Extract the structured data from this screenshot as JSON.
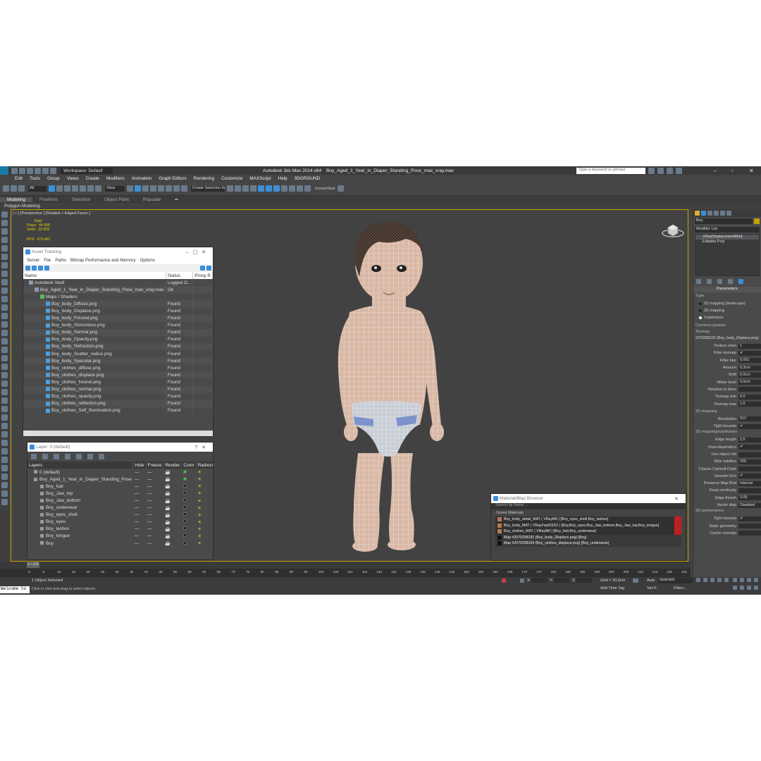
{
  "app": {
    "title": "Autodesk 3ds Max  2014 x64",
    "file": "Boy_Aged_1_Year_in_Diaper_Standing_Pose_max_vray.max",
    "workspace": "Workspace: Default",
    "search_placeholder": "Type a keyword or phrase"
  },
  "menu": [
    "Edit",
    "Tools",
    "Group",
    "Views",
    "Create",
    "Modifiers",
    "Animation",
    "Graph Editors",
    "Rendering",
    "Customize",
    "MAXScript",
    "Help",
    "3DGROUND"
  ],
  "toolbar": {
    "selection_filter": "All",
    "view": "View",
    "named_set": "Create Selection Se",
    "screenshot": "ScreenShot"
  },
  "ribbon": {
    "tabs": [
      "Modeling",
      "Freeform",
      "Selection",
      "Object Paint",
      "Populate"
    ],
    "sub": "Polygon Modeling"
  },
  "viewport": {
    "label": "[ + ] [Perspective ] [Shaded + Edged Faces ]",
    "stats": {
      "total": "Total",
      "polys_label": "Polys:",
      "polys": "44 568",
      "verts_label": "Verts:",
      "verts": "33 059",
      "fps_label": "FPS:",
      "fps": "479,462"
    }
  },
  "asset_tracking": {
    "title": "Asset Tracking",
    "menu": [
      "Server",
      "File",
      "Paths",
      "Bitmap Performance and Memory",
      "Options"
    ],
    "columns": [
      "Name",
      "Status",
      "Proxy R"
    ],
    "rows": [
      {
        "name": "Autodesk Vault",
        "status": "Logged O...",
        "indent": 1
      },
      {
        "name": "Boy_Aged_1_Year_in_Diaper_Standing_Pose_max_vray.max",
        "status": "Ok",
        "indent": 2
      },
      {
        "name": "Maps / Shaders",
        "status": "",
        "indent": 3
      },
      {
        "name": "Boy_body_Diffuse.png",
        "status": "Found",
        "indent": 4
      },
      {
        "name": "Boy_body_Displace.png",
        "status": "Found",
        "indent": 4
      },
      {
        "name": "Boy_body_Fresnel.png",
        "status": "Found",
        "indent": 4
      },
      {
        "name": "Boy_body_Glossiness.png",
        "status": "Found",
        "indent": 4
      },
      {
        "name": "Boy_body_Normal.png",
        "status": "Found",
        "indent": 4
      },
      {
        "name": "Boy_body_Opacity.png",
        "status": "Found",
        "indent": 4
      },
      {
        "name": "Boy_body_Refraction.png",
        "status": "Found",
        "indent": 4
      },
      {
        "name": "Boy_body_Scatter_radius.png",
        "status": "Found",
        "indent": 4
      },
      {
        "name": "Boy_body_Specular.png",
        "status": "Found",
        "indent": 4
      },
      {
        "name": "Boy_clothes_diffuse.png",
        "status": "Found",
        "indent": 4
      },
      {
        "name": "Boy_clothes_displace.png",
        "status": "Found",
        "indent": 4
      },
      {
        "name": "Boy_clothes_fresnel.png",
        "status": "Found",
        "indent": 4
      },
      {
        "name": "Boy_clothes_normal.png",
        "status": "Found",
        "indent": 4
      },
      {
        "name": "Boy_clothes_opacity.png",
        "status": "Found",
        "indent": 4
      },
      {
        "name": "Boy_clothes_reflection.png",
        "status": "Found",
        "indent": 4
      },
      {
        "name": "Boy_clothes_Self_Illumination.png",
        "status": "Found",
        "indent": 4
      }
    ]
  },
  "layer": {
    "title": "Layer: 0 (default)",
    "columns": [
      "Layers",
      "Hide",
      "Freeze",
      "Render",
      "Color",
      "Radiosity"
    ],
    "rows": [
      {
        "name": "0 (default)",
        "indent": 1,
        "color": "g"
      },
      {
        "name": "Boy_Aged_1_Year_in_Diaper_Standing_Pose",
        "indent": 1,
        "color": "g"
      },
      {
        "name": "Boy_hair",
        "indent": 2,
        "color": ""
      },
      {
        "name": "Boy_Jaw_top",
        "indent": 2,
        "color": ""
      },
      {
        "name": "Boy_Jaw_bottom",
        "indent": 2,
        "color": ""
      },
      {
        "name": "Boy_underwear",
        "indent": 2,
        "color": ""
      },
      {
        "name": "Boy_eyes_shell",
        "indent": 2,
        "color": ""
      },
      {
        "name": "Boy_eyes",
        "indent": 2,
        "color": ""
      },
      {
        "name": "Boy_lashes",
        "indent": 2,
        "color": ""
      },
      {
        "name": "Boy_tongue",
        "indent": 2,
        "color": ""
      },
      {
        "name": "Boy",
        "indent": 2,
        "color": ""
      }
    ]
  },
  "material_browser": {
    "title": "Material/Map Browser",
    "search": "Search by Name ...",
    "section": "- Scene Materials",
    "rows": [
      "Boy_body_detail_MAT ( VRayMtl ) [Boy_eyes_shell,Boy_lashes]",
      "Boy_body_MAT ( VRayFastSSS2 ) [Boy,Boy_eyes,Boy_Jaw_bottom,Boy_Jaw_top,Boy_tongue]",
      "Boy_clothes_MAT ( VRayMtl ) [Boy_hair,Boy_underwear]",
      "Map #2070298191 (Boy_body_Displace.png) [Boy]",
      "Map #2070298194 (Boy_clothes_displace.png) [Boy_underwear]"
    ]
  },
  "right_panel": {
    "name": "Boy",
    "modifier_list": "Modifier List",
    "stack": [
      "VRayDisplacementMod",
      "Editable Poly"
    ],
    "parameters": "Parameters",
    "type": "Type",
    "types": [
      "2D mapping (landscape)",
      "3D mapping",
      "Subdivision"
    ],
    "common": "Common params",
    "texmap": "Texmap",
    "texmap_value": "2070298191 (Boy_body_Displace.png)",
    "params1": [
      {
        "l": "Texture chan",
        "v": "1"
      },
      {
        "l": "Filter texmap",
        "v": "✔"
      },
      {
        "l": "Filter blur",
        "v": "0,001"
      },
      {
        "l": "Amount",
        "v": "0,3cm"
      },
      {
        "l": "Shift",
        "v": "0,0cm"
      },
      {
        "l": "Water level",
        "v": "0,0cm"
      },
      {
        "l": "Relative to bbox",
        "v": ""
      },
      {
        "l": "Texmap min",
        "v": "0,0"
      },
      {
        "l": "Texmap max",
        "v": "1,0"
      }
    ],
    "mapping2d": "2D mapping",
    "params2": [
      {
        "l": "Resolution",
        "v": "512"
      },
      {
        "l": "Tight bounds",
        "v": "✔"
      }
    ],
    "mapping3d": "3D mapping/subdivision",
    "params3": [
      {
        "l": "Edge length",
        "v": "2,0"
      },
      {
        "l": "View-dependent",
        "v": "✔"
      },
      {
        "l": "Use object mtl",
        "v": ""
      },
      {
        "l": "Max subdivs",
        "v": "256"
      },
      {
        "l": "Classic Catmull-Clark",
        "v": ""
      },
      {
        "l": "Smooth UVs",
        "v": "✔"
      },
      {
        "l": "Preserve Map Bnd",
        "v": "Internal"
      },
      {
        "l": "Keep continuity",
        "v": ""
      },
      {
        "l": "Edge thresh",
        "v": "0,05"
      },
      {
        "l": "Vector disp",
        "v": "Disabled"
      }
    ],
    "perf": "3D performance",
    "params4": [
      {
        "l": "Tight bounds",
        "v": "✔"
      },
      {
        "l": "Static geometry",
        "v": ""
      },
      {
        "l": "Cache normals",
        "v": ""
      }
    ]
  },
  "timeline": {
    "frame": "0 / 225",
    "ticks": [
      "0",
      "5",
      "10",
      "15",
      "20",
      "25",
      "30",
      "35",
      "40",
      "45",
      "50",
      "55",
      "60",
      "65",
      "70",
      "75",
      "80",
      "85",
      "90",
      "95",
      "100",
      "105",
      "110",
      "115",
      "120",
      "125",
      "130",
      "135",
      "140",
      "145",
      "150",
      "155",
      "160",
      "165",
      "170",
      "175",
      "180",
      "185",
      "190",
      "195",
      "200",
      "205",
      "210",
      "215",
      "220",
      "225"
    ]
  },
  "status": {
    "selected": "1 Object Selected",
    "hint": "Click or click-and-drag to select objects",
    "welcome": "Welcome to",
    "x": "X:",
    "y": "Y:",
    "z": "Z:",
    "grid": "Grid = 10,0cm",
    "autokey": "Auto",
    "setkey": "Set K.",
    "selected_dd": "Selected",
    "filters": "Filters...",
    "add_time_tag": "Add Time Tag"
  }
}
